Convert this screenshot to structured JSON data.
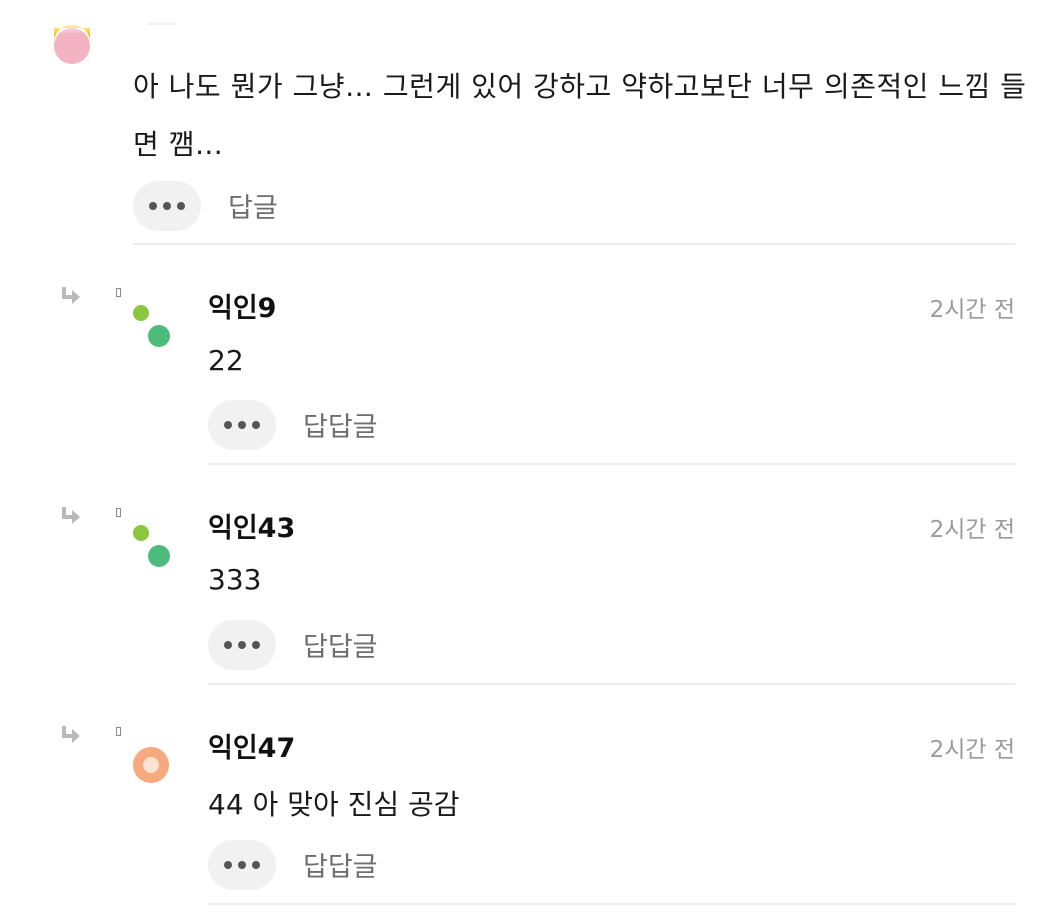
{
  "top_comment": {
    "text": "아 나도 뭔가 그냥… 그런게 있어 강하고 약하고보단 너무 의존적인 느낌 들면 깸…",
    "reply_label": "답글"
  },
  "replies": [
    {
      "nickname": "익인9",
      "time": "2시간 전",
      "text": "22",
      "reply_label": "답답글"
    },
    {
      "nickname": "익인43",
      "time": "2시간 전",
      "text": "333",
      "reply_label": "답답글"
    },
    {
      "nickname": "익인47",
      "time": "2시간 전",
      "text": "44 아 맞아 진심 공감",
      "reply_label": "답답글"
    }
  ],
  "colors": {
    "avatar_top_yellow": "#f9c80e",
    "avatar_top_pink": "#f3b3c3",
    "avatar_green_light": "#8cc63f",
    "avatar_green": "#4cbb7b",
    "avatar_orange": "#f6a87e",
    "more_pill_bg": "#f1f1f1",
    "divider": "#ececec"
  },
  "icons": [
    "reply-arrow-icon",
    "more-dots-icon"
  ]
}
